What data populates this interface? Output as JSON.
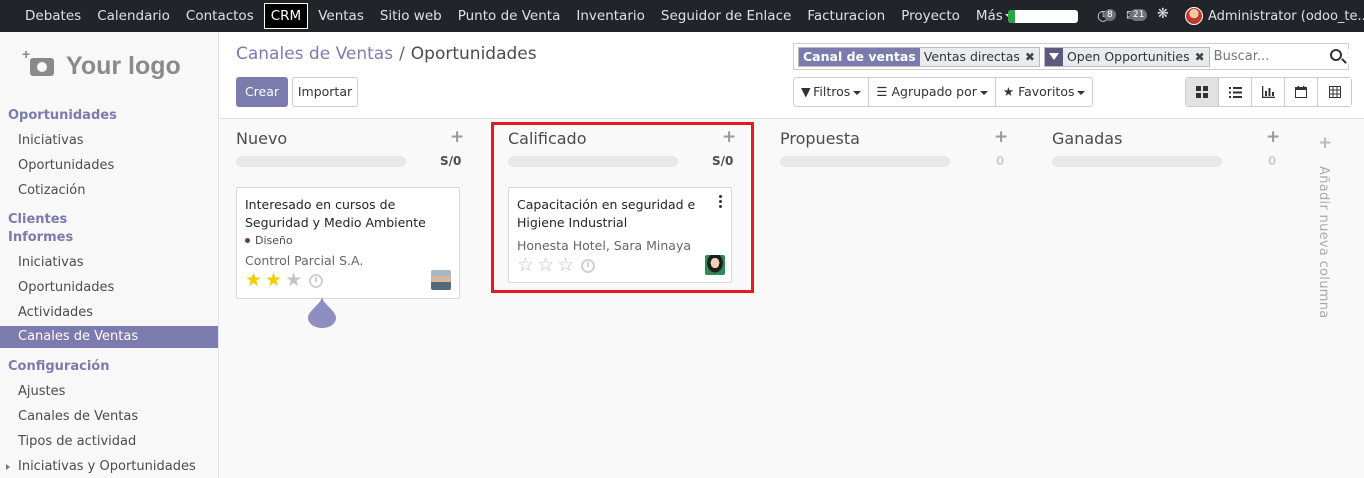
{
  "topbar": {
    "menu": [
      "Debates",
      "Calendario",
      "Contactos",
      "CRM",
      "Ventas",
      "Sitio web",
      "Punto de Venta",
      "Inventario",
      "Seguidor de Enlace",
      "Facturacion",
      "Proyecto",
      "Más"
    ],
    "active": "CRM",
    "progress": 0.1,
    "activities_badge": "8",
    "messages_badge": "21",
    "user": "Administrator (odoo_te..."
  },
  "sidebar": {
    "logo": "Your logo",
    "sections": [
      {
        "title": "Oportunidades",
        "items": [
          "Iniciativas",
          "Oportunidades",
          "Cotización"
        ]
      },
      {
        "title": "Clientes",
        "items": []
      },
      {
        "title": "Informes",
        "items": [
          "Iniciativas",
          "Oportunidades",
          "Actividades",
          "Canales de Ventas"
        ]
      },
      {
        "title": "Configuración",
        "items": [
          "Ajustes",
          "Canales de Ventas",
          "Tipos de actividad",
          "Iniciativas y Oportunidades"
        ]
      }
    ],
    "active_item": "Canales de Ventas"
  },
  "control": {
    "breadcrumb_parent": "Canales de Ventas",
    "breadcrumb_sep": "/",
    "breadcrumb_current": "Oportunidades",
    "create_label": "Crear",
    "import_label": "Importar",
    "search": {
      "facet1_name": "Canal de ventas",
      "facet1_value": "Ventas directas",
      "facet2_value": "Open Opportunities",
      "remove_glyph": "✖",
      "placeholder": "Buscar..."
    },
    "filters_label": "Filtros",
    "groupby_label": "Agrupado por",
    "favorites_label": "Favoritos"
  },
  "kanban": {
    "columns": [
      {
        "title": "Nuevo",
        "sum": "S/0",
        "progress": 0
      },
      {
        "title": "Calificado",
        "sum": "S/0",
        "progress": 0
      },
      {
        "title": "Propuesta",
        "sum": "0",
        "progress": 0
      },
      {
        "title": "Ganadas",
        "sum": "0",
        "progress": 0
      }
    ],
    "add_column": "Añadir nueva columna",
    "cards": [
      {
        "title": "Interesado en cursos de Seguridad y Medio Ambiente",
        "tag": "Diseño",
        "partner": "Control Parcial S.A.",
        "stars": 2,
        "max_stars": 3
      },
      {
        "title": "Capacitación en seguridad e Higiene Industrial",
        "partner": "Honesta Hotel, Sara Minaya",
        "stars": 0,
        "max_stars": 3
      }
    ]
  },
  "colors": {
    "accent": "#7c7bad",
    "topbar": "#212529",
    "highlight": "#e01b24",
    "star": "#f3cc00"
  }
}
